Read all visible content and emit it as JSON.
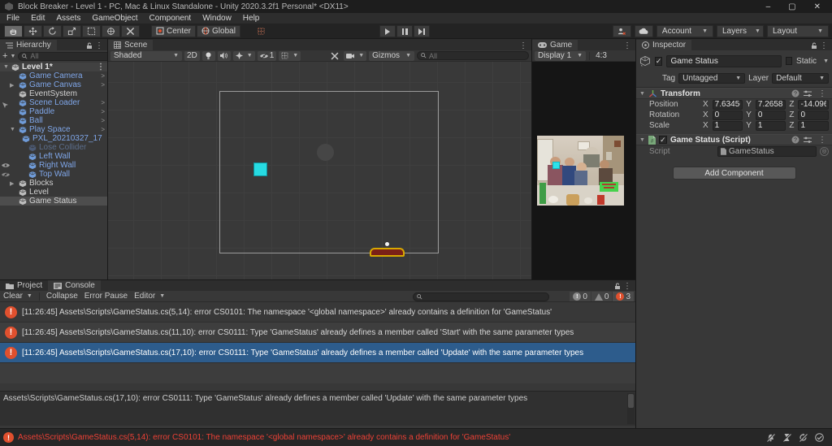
{
  "title_bar": {
    "title": "Block Breaker - Level 1 - PC, Mac & Linux Standalone - Unity 2020.3.2f1 Personal* <DX11>",
    "minimize": "–",
    "maximize": "▢",
    "close": "✕"
  },
  "menu_bar": {
    "items": [
      {
        "label": "File"
      },
      {
        "label": "Edit"
      },
      {
        "label": "Assets"
      },
      {
        "label": "GameObject"
      },
      {
        "label": "Component"
      },
      {
        "label": "Window"
      },
      {
        "label": "Help"
      }
    ]
  },
  "toolbar": {
    "center_label": "Center",
    "global_label": "Global",
    "account_label": "Account",
    "layers_label": "Layers",
    "layout_label": "Layout"
  },
  "hierarchy": {
    "tab": "Hierarchy",
    "create_label": "+",
    "search_placeholder": "All",
    "scene_name": "Level 1*",
    "items": [
      {
        "label": "Game Camera",
        "style": "prefab",
        "indent": 1,
        "arrow": true
      },
      {
        "label": "Game Canvas",
        "style": "prefab",
        "indent": 1,
        "expander": "closed",
        "arrow": true
      },
      {
        "label": "EventSystem",
        "style": "normal",
        "indent": 1
      },
      {
        "label": "Scene Loader",
        "style": "prefab",
        "indent": 1,
        "arrow": true
      },
      {
        "label": "Paddle",
        "style": "prefab",
        "indent": 1,
        "arrow": true
      },
      {
        "label": "Ball",
        "style": "prefab",
        "indent": 1,
        "arrow": true
      },
      {
        "label": "Play Space",
        "style": "prefab",
        "indent": 1,
        "expander": "open",
        "arrow": true
      },
      {
        "label": "PXL_20210327_17",
        "style": "prefab",
        "indent": 2
      },
      {
        "label": "Lose Collider",
        "style": "disabled",
        "indent": 2
      },
      {
        "label": "Left Wall",
        "style": "prefab",
        "indent": 2
      },
      {
        "label": "Right Wall",
        "style": "prefab",
        "indent": 2
      },
      {
        "label": "Top Wall",
        "style": "prefab",
        "indent": 2
      },
      {
        "label": "Blocks",
        "style": "normal",
        "indent": 1,
        "expander": "closed"
      },
      {
        "label": "Level",
        "style": "normal",
        "indent": 1
      },
      {
        "label": "Game Status",
        "style": "normal",
        "indent": 1,
        "selected": true
      }
    ]
  },
  "scene_view": {
    "tab": "Scene",
    "shading_mode": "Shaded",
    "mode_2d": "2D",
    "hidden_count": "1",
    "gizmos_label": "Gizmos",
    "search_placeholder": "All"
  },
  "game_view": {
    "tab": "Game",
    "display": "Display 1",
    "aspect": "4:3"
  },
  "inspector": {
    "tab": "Inspector",
    "object_name": "Game Status",
    "static_label": "Static",
    "tag_label": "Tag",
    "tag_value": "Untagged",
    "layer_label": "Layer",
    "layer_value": "Default",
    "transform": {
      "title": "Transform",
      "rows": [
        {
          "label": "Position",
          "xl": "X",
          "xv": "7.634568",
          "yl": "Y",
          "yv": "7.265853",
          "zl": "Z",
          "zv": "-14.0962"
        },
        {
          "label": "Rotation",
          "xl": "X",
          "xv": "0",
          "yl": "Y",
          "yv": "0",
          "zl": "Z",
          "zv": "0"
        },
        {
          "label": "Scale",
          "xl": "X",
          "xv": "1",
          "yl": "Y",
          "yv": "1",
          "zl": "Z",
          "zv": "1"
        }
      ]
    },
    "script_component": {
      "title": "Game Status (Script)",
      "field_label": "Script",
      "value": "GameStatus"
    },
    "add_component_label": "Add Component",
    "check_glyph": "✓"
  },
  "console": {
    "tab_project": "Project",
    "tab_console": "Console",
    "clear_label": "Clear",
    "collapse_label": "Collapse",
    "error_pause_label": "Error Pause",
    "editor_label": "Editor",
    "counts": {
      "info": "0",
      "warning": "0",
      "error": "3"
    },
    "entries": [
      {
        "text": "[11:26:45] Assets\\Scripts\\GameStatus.cs(5,14): error CS0101: The namespace '<global namespace>' already contains a definition for 'GameStatus'"
      },
      {
        "text": "[11:26:45] Assets\\Scripts\\GameStatus.cs(11,10): error CS0111: Type 'GameStatus' already defines a member called 'Start' with the same parameter types"
      },
      {
        "text": "[11:26:45] Assets\\Scripts\\GameStatus.cs(17,10): error CS0111: Type 'GameStatus' already defines a member called 'Update' with the same parameter types",
        "selected": true
      }
    ],
    "detail": "Assets\\Scripts\\GameStatus.cs(17,10): error CS0111: Type 'GameStatus' already defines a member called 'Update' with the same parameter types"
  },
  "status_bar": {
    "message": "Assets\\Scripts\\GameStatus.cs(5,14): error CS0101: The namespace '<global namespace>' already contains a definition for 'GameStatus'"
  },
  "colors": {
    "prefab_blue": "#7fa6e8",
    "selected_row_blue": "#2d5c8c",
    "error_red": "#e0502e",
    "status_error_text": "#ee4136",
    "block_cyan": "#27dbe2",
    "paddle_yellow": "#d8a800"
  }
}
